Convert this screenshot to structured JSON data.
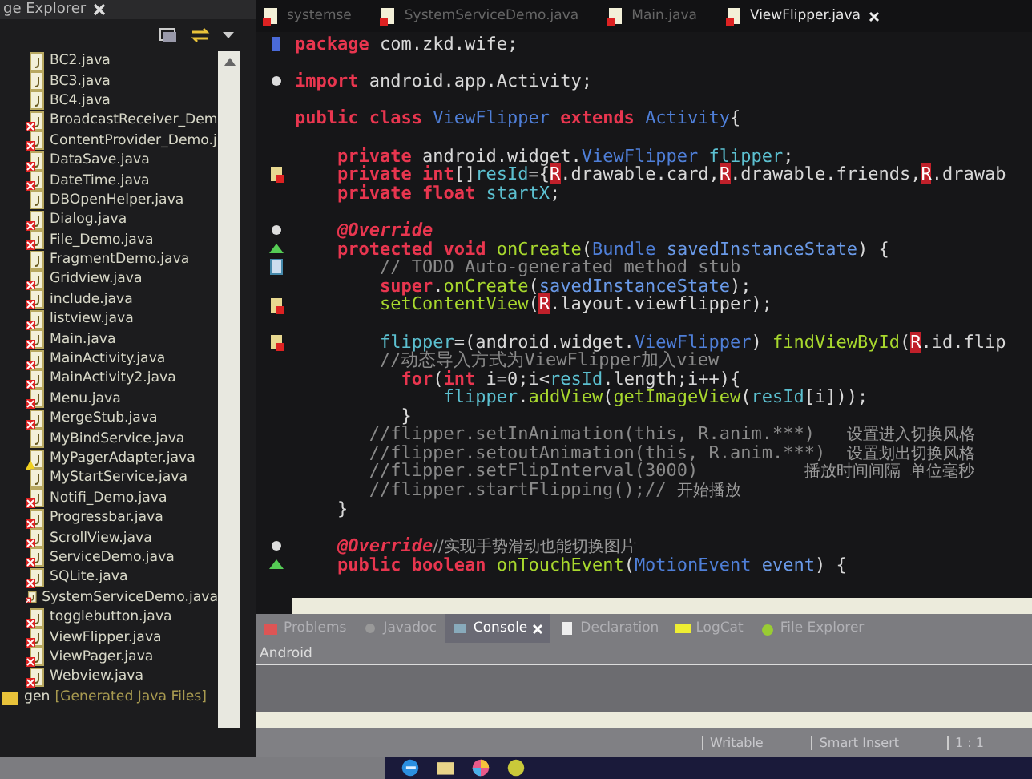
{
  "explorer": {
    "title": "ge Explorer",
    "files": [
      {
        "name": "BC2.java",
        "has_error": false,
        "has_warning": false
      },
      {
        "name": "BC3.java",
        "has_error": false,
        "has_warning": false
      },
      {
        "name": "BC4.java",
        "has_error": false,
        "has_warning": false
      },
      {
        "name": "BroadcastReceiver_Dem",
        "has_error": true,
        "has_warning": false
      },
      {
        "name": "ContentProvider_Demo.j",
        "has_error": true,
        "has_warning": false
      },
      {
        "name": "DataSave.java",
        "has_error": true,
        "has_warning": false
      },
      {
        "name": "DateTime.java",
        "has_error": true,
        "has_warning": false
      },
      {
        "name": "DBOpenHelper.java",
        "has_error": false,
        "has_warning": false
      },
      {
        "name": "Dialog.java",
        "has_error": true,
        "has_warning": false
      },
      {
        "name": "File_Demo.java",
        "has_error": true,
        "has_warning": false
      },
      {
        "name": "FragmentDemo.java",
        "has_error": false,
        "has_warning": false
      },
      {
        "name": "Gridview.java",
        "has_error": true,
        "has_warning": false
      },
      {
        "name": "include.java",
        "has_error": true,
        "has_warning": false
      },
      {
        "name": "listview.java",
        "has_error": true,
        "has_warning": false
      },
      {
        "name": "Main.java",
        "has_error": true,
        "has_warning": false
      },
      {
        "name": "MainActivity.java",
        "has_error": true,
        "has_warning": false
      },
      {
        "name": "MainActivity2.java",
        "has_error": true,
        "has_warning": false
      },
      {
        "name": "Menu.java",
        "has_error": true,
        "has_warning": false
      },
      {
        "name": "MergeStub.java",
        "has_error": true,
        "has_warning": false
      },
      {
        "name": "MyBindService.java",
        "has_error": false,
        "has_warning": false
      },
      {
        "name": "MyPagerAdapter.java",
        "has_error": false,
        "has_warning": true
      },
      {
        "name": "MyStartService.java",
        "has_error": false,
        "has_warning": false
      },
      {
        "name": "Notifi_Demo.java",
        "has_error": true,
        "has_warning": false
      },
      {
        "name": "Progressbar.java",
        "has_error": true,
        "has_warning": false
      },
      {
        "name": "ScrollView.java",
        "has_error": true,
        "has_warning": false
      },
      {
        "name": "ServiceDemo.java",
        "has_error": true,
        "has_warning": false
      },
      {
        "name": "SQLite.java",
        "has_error": true,
        "has_warning": false
      },
      {
        "name": "SystemServiceDemo.java",
        "has_error": true,
        "has_warning": false
      },
      {
        "name": "togglebutton.java",
        "has_error": true,
        "has_warning": false
      },
      {
        "name": "ViewFlipper.java",
        "has_error": true,
        "has_warning": false
      },
      {
        "name": "ViewPager.java",
        "has_error": true,
        "has_warning": false
      },
      {
        "name": "Webview.java",
        "has_error": true,
        "has_warning": false
      }
    ],
    "gen": {
      "name": "gen",
      "note": "[Generated Java Files]"
    }
  },
  "editor": {
    "tabs": [
      {
        "label": "systemse",
        "selected": false
      },
      {
        "label": "SystemServiceDemo.java",
        "selected": false
      },
      {
        "label": "Main.java",
        "selected": false
      },
      {
        "label": "ViewFlipper.java",
        "selected": true
      }
    ],
    "lines": [
      {
        "kind": "caret",
        "tokens": [
          {
            "kind": "kw",
            "text": "package"
          },
          {
            "kind": "plain",
            "text": " com.zkd.wife;"
          }
        ]
      },
      {
        "space_before": true,
        "kind": "fold",
        "tokens": [
          {
            "kind": "kw",
            "text": "import"
          },
          {
            "kind": "plain",
            "text": " android.app.Activity;"
          }
        ]
      },
      {
        "space_before": true,
        "tokens": [
          {
            "kind": "kw",
            "text": "public class "
          },
          {
            "kind": "type",
            "text": "ViewFlipper"
          },
          {
            "kind": "kw",
            "text": " extends "
          },
          {
            "kind": "type",
            "text": "Activity"
          },
          {
            "kind": "plain",
            "text": "{"
          }
        ]
      },
      {
        "space_before": true,
        "tokens": [
          {
            "kind": "kw",
            "text": "    private"
          },
          {
            "kind": "plain",
            "text": " android.widget."
          },
          {
            "kind": "type",
            "text": "ViewFlipper"
          },
          {
            "kind": "field",
            "text": " flipper"
          },
          {
            "kind": "plain",
            "text": ";"
          }
        ]
      },
      {
        "kind": "warning",
        "tokens": [
          {
            "kind": "kw",
            "text": "    private int"
          },
          {
            "kind": "plain",
            "text": "[]"
          },
          {
            "kind": "field",
            "text": "resId"
          },
          {
            "kind": "plain",
            "text": "={"
          },
          {
            "kind": "rref",
            "text": "R"
          },
          {
            "kind": "plain",
            "text": ".drawable.card,"
          },
          {
            "kind": "rref",
            "text": "R"
          },
          {
            "kind": "plain",
            "text": ".drawable.friends,"
          },
          {
            "kind": "rref",
            "text": "R"
          },
          {
            "kind": "plain",
            "text": ".drawab"
          }
        ]
      },
      {
        "tokens": [
          {
            "kind": "kw",
            "text": "    private float"
          },
          {
            "kind": "field",
            "text": " startX"
          },
          {
            "kind": "plain",
            "text": ";"
          }
        ]
      },
      {
        "space_before": true,
        "kind": "fold",
        "tokens": [
          {
            "kind": "annotation",
            "text": "    @Override"
          }
        ]
      },
      {
        "kind": "override",
        "tokens": [
          {
            "kind": "kw",
            "text": "    protected void"
          },
          {
            "kind": "method",
            "text": " onCreate"
          },
          {
            "kind": "plain",
            "text": "("
          },
          {
            "kind": "type",
            "text": "Bundle"
          },
          {
            "kind": "param",
            "text": " savedInstanceState"
          },
          {
            "kind": "plain",
            "text": ") {"
          }
        ]
      },
      {
        "kind": "task",
        "tokens": [
          {
            "kind": "comment",
            "text": "        // TODO Auto-generated method stub"
          }
        ]
      },
      {
        "tokens": [
          {
            "kind": "kw",
            "text": "        super"
          },
          {
            "kind": "plain",
            "text": "."
          },
          {
            "kind": "method",
            "text": "onCreate"
          },
          {
            "kind": "plain",
            "text": "("
          },
          {
            "kind": "param",
            "text": "savedInstanceState"
          },
          {
            "kind": "plain",
            "text": ");"
          }
        ]
      },
      {
        "kind": "warning",
        "tokens": [
          {
            "kind": "method",
            "text": "        setContentView"
          },
          {
            "kind": "plain",
            "text": "("
          },
          {
            "kind": "rref",
            "text": "R"
          },
          {
            "kind": "plain",
            "text": ".layout.viewflipper);"
          }
        ]
      },
      {
        "space_before": true,
        "kind": "warning",
        "tokens": [
          {
            "kind": "field",
            "text": "        flipper"
          },
          {
            "kind": "plain",
            "text": "=(android.widget."
          },
          {
            "kind": "type",
            "text": "ViewFlipper"
          },
          {
            "kind": "plain",
            "text": ") "
          },
          {
            "kind": "method",
            "text": "findViewById"
          },
          {
            "kind": "plain",
            "text": "("
          },
          {
            "kind": "rref",
            "text": "R"
          },
          {
            "kind": "plain",
            "text": ".id.flip"
          }
        ]
      },
      {
        "tokens": [
          {
            "kind": "comment",
            "text": "        //动态导入方式为ViewFlipper加入view"
          }
        ]
      },
      {
        "tokens": [
          {
            "kind": "kw",
            "text": "          for"
          },
          {
            "kind": "plain",
            "text": "("
          },
          {
            "kind": "kw",
            "text": "int"
          },
          {
            "kind": "plain",
            "text": " i=0;i<"
          },
          {
            "kind": "field",
            "text": "resId"
          },
          {
            "kind": "plain",
            "text": ".length;i++){"
          }
        ]
      },
      {
        "tokens": [
          {
            "kind": "field",
            "text": "              flipper"
          },
          {
            "kind": "plain",
            "text": "."
          },
          {
            "kind": "method",
            "text": "addView"
          },
          {
            "kind": "plain",
            "text": "("
          },
          {
            "kind": "method",
            "text": "getImageView"
          },
          {
            "kind": "plain",
            "text": "("
          },
          {
            "kind": "field",
            "text": "resId"
          },
          {
            "kind": "plain",
            "text": "[i]));"
          }
        ]
      },
      {
        "tokens": [
          {
            "kind": "plain",
            "text": "          }"
          }
        ]
      },
      {
        "tokens": [
          {
            "kind": "comment",
            "text": "       //flipper.setInAnimation(this, R.anim.***)   "
          },
          {
            "kind": "note",
            "text": "设置进入切换风格"
          }
        ]
      },
      {
        "tokens": [
          {
            "kind": "comment",
            "text": "       //flipper.setoutAnimation(this, R.anim.***)  "
          },
          {
            "kind": "note",
            "text": "设置划出切换风格"
          }
        ]
      },
      {
        "tokens": [
          {
            "kind": "comment",
            "text": "       //flipper.setFlipInterval(3000)          "
          },
          {
            "kind": "note",
            "text": "播放时间间隔  单位毫秒"
          }
        ]
      },
      {
        "tokens": [
          {
            "kind": "comment",
            "text": "       //flipper.startFlipping();// "
          },
          {
            "kind": "note",
            "text": "开始播放"
          }
        ]
      },
      {
        "tokens": [
          {
            "kind": "plain",
            "text": "    }"
          }
        ]
      },
      {
        "space_before": true,
        "kind": "fold",
        "tokens": [
          {
            "kind": "annotation",
            "text": "    @Override"
          },
          {
            "kind": "note",
            "text": "//实现手势滑动也能切换图片"
          }
        ]
      },
      {
        "kind": "override",
        "tokens": [
          {
            "kind": "kw",
            "text": "    public boolean"
          },
          {
            "kind": "method",
            "text": " onTouchEvent"
          },
          {
            "kind": "plain",
            "text": "("
          },
          {
            "kind": "type",
            "text": "MotionEvent"
          },
          {
            "kind": "param",
            "text": " event"
          },
          {
            "kind": "plain",
            "text": ") {"
          }
        ]
      }
    ]
  },
  "bottom_panel": {
    "tabs": [
      {
        "label": "Problems",
        "selected": false
      },
      {
        "label": "Javadoc",
        "selected": false
      },
      {
        "label": "Console",
        "selected": true
      },
      {
        "label": "Declaration",
        "selected": false
      },
      {
        "label": "LogCat",
        "selected": false
      },
      {
        "label": "File Explorer",
        "selected": false
      }
    ],
    "console_title": "Android"
  },
  "status_bar": [
    "Writable",
    "Smart Insert",
    "1 : 1"
  ]
}
